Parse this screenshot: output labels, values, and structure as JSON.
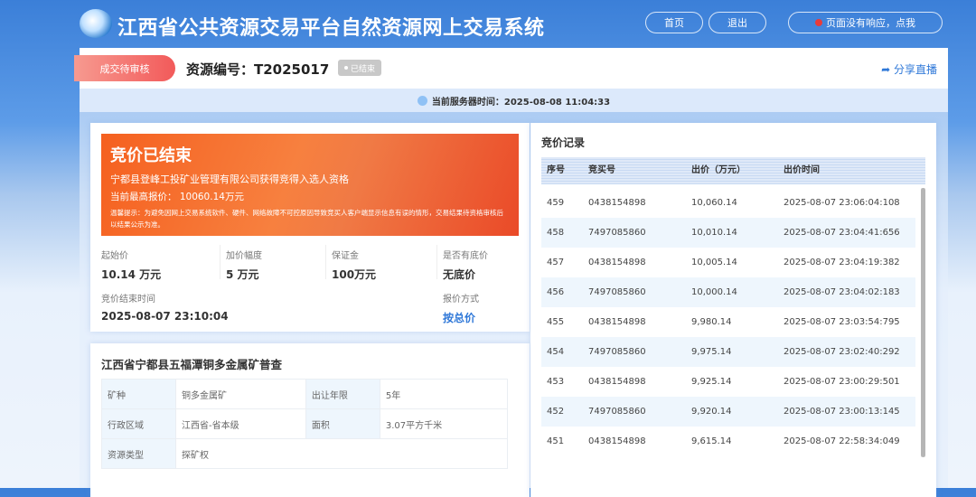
{
  "header": {
    "title": "江西省公共资源交易平台自然资源网上交易系统",
    "home": "首页",
    "logout": "退出",
    "no_response": "页面没有响应，点我"
  },
  "top": {
    "status": "成交待审核",
    "resource_id": "资源编号：T2025017",
    "ended_badge": "已结束",
    "share": "分享直播"
  },
  "server_time": "当前服务器时间：2025-08-08 11:04:33",
  "banner": {
    "title": "竞价已结束",
    "winner": "宁都县登峰工投矿业管理有限公司获得竞得入选人资格",
    "highest": "当前最高报价：  10060.14万元",
    "notice": "温馨提示：为避免因网上交易系统软件、硬件、网络故障不可控原因导致竞买人客户端显示信息有误的情形，交易结果待资格审核后以结果公示为准。"
  },
  "info": [
    {
      "label": "起始价",
      "value": "10.14 万元"
    },
    {
      "label": "加价幅度",
      "value": "5 万元"
    },
    {
      "label": "保证金",
      "value": "100万元"
    },
    {
      "label": "是否有底价",
      "value": "无底价"
    },
    {
      "label": "竞价结束时间",
      "value": "2025-08-07 23:10:04"
    },
    {
      "label": "报价方式",
      "value": "按总价"
    }
  ],
  "detail": {
    "title": "江西省宁都县五福潭铜多金属矿普查",
    "rows": [
      [
        "矿种",
        "铜多金属矿",
        "出让年限",
        "5年"
      ],
      [
        "行政区域",
        "江西省-省本级",
        "面积",
        "3.07平方千米"
      ],
      [
        "资源类型",
        "探矿权"
      ]
    ]
  },
  "records": {
    "title": "竞价记录",
    "headers": [
      "序号",
      "竞买号",
      "出价（万元）",
      "出价时间"
    ],
    "rows": [
      [
        "459",
        "0438154898",
        "10,060.14",
        "2025-08-07 23:06:04:108"
      ],
      [
        "458",
        "7497085860",
        "10,010.14",
        "2025-08-07 23:04:41:656"
      ],
      [
        "457",
        "0438154898",
        "10,005.14",
        "2025-08-07 23:04:19:382"
      ],
      [
        "456",
        "7497085860",
        "10,000.14",
        "2025-08-07 23:04:02:183"
      ],
      [
        "455",
        "0438154898",
        "9,980.14",
        "2025-08-07 23:03:54:795"
      ],
      [
        "454",
        "7497085860",
        "9,975.14",
        "2025-08-07 23:02:40:292"
      ],
      [
        "453",
        "0438154898",
        "9,925.14",
        "2025-08-07 23:00:29:501"
      ],
      [
        "452",
        "7497085860",
        "9,920.14",
        "2025-08-07 23:00:13:145"
      ],
      [
        "451",
        "0438154898",
        "9,615.14",
        "2025-08-07 22:58:34:049"
      ]
    ]
  },
  "colors": {
    "accent": "#2f78d8",
    "banner": "#f5601f"
  }
}
